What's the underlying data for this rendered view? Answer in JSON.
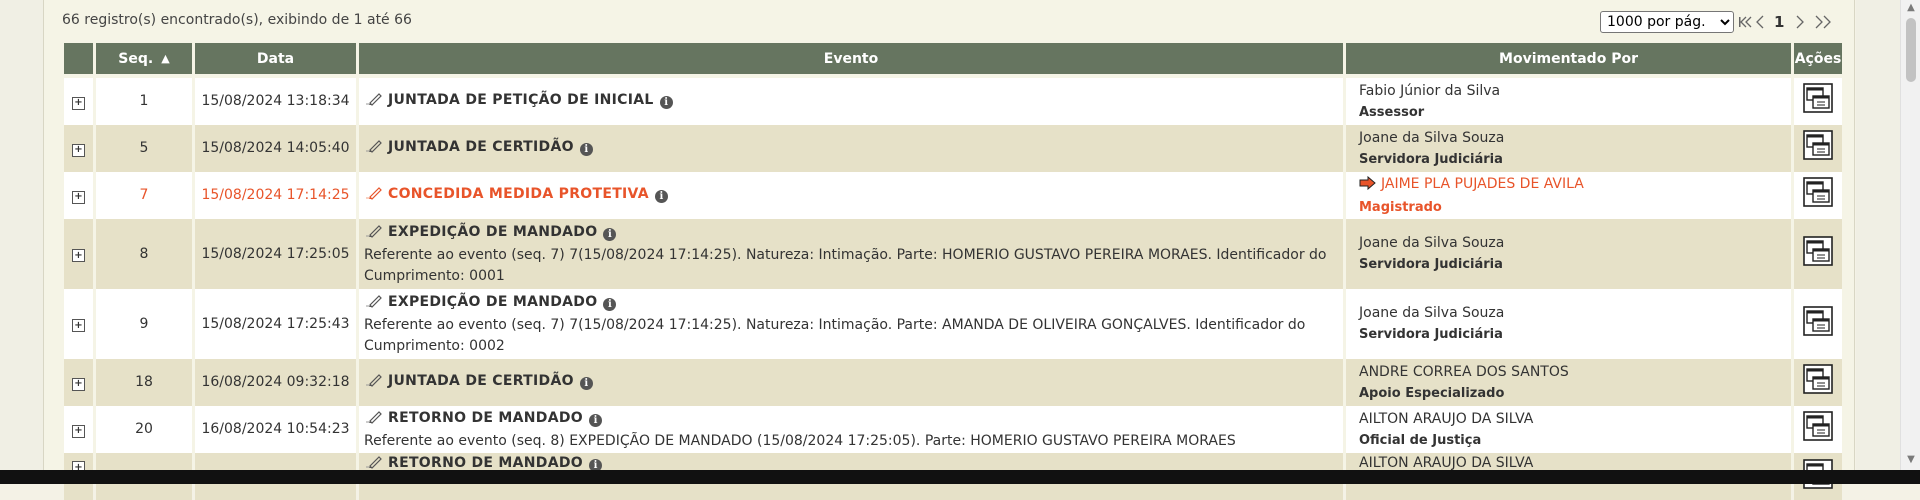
{
  "results": {
    "summary": "66 registro(s) encontrado(s), exibindo de 1 até 66",
    "per_page": "1000 por pág.",
    "per_page_options": [
      "1000 por pág."
    ],
    "current_page": "1"
  },
  "table": {
    "headers": {
      "seq": "Seq.",
      "data": "Data",
      "evento": "Evento",
      "movimentado_por": "Movimentado Por",
      "acoes": "Ações"
    },
    "rows": [
      {
        "seq": "1",
        "data": "15/08/2024 13:18:34",
        "evento": "JUNTADA DE PETIÇÃO DE INICIAL",
        "descricao": "",
        "movimentado_por": "Fabio Júnior da Silva",
        "cargo": "Assessor"
      },
      {
        "seq": "5",
        "data": "15/08/2024 14:05:40",
        "evento": "JUNTADA DE CERTIDÃO",
        "descricao": "",
        "movimentado_por": "Joane da Silva Souza",
        "cargo": "Servidora Judiciária"
      },
      {
        "seq": "7",
        "data": "15/08/2024 17:14:25",
        "evento": "CONCEDIDA MEDIDA PROTETIVA",
        "descricao": "",
        "movimentado_por": "JAIME PLA PUJADES DE AVILA",
        "cargo": "Magistrado"
      },
      {
        "seq": "8",
        "data": "15/08/2024 17:25:05",
        "evento": "EXPEDIÇÃO DE MANDADO",
        "descricao": "Referente ao evento (seq. 7) 7(15/08/2024 17:14:25). Natureza: Intimação. Parte: HOMERIO GUSTAVO PEREIRA MORAES. Identificador do Cumprimento: 0001",
        "movimentado_por": "Joane da Silva Souza",
        "cargo": "Servidora Judiciária"
      },
      {
        "seq": "9",
        "data": "15/08/2024 17:25:43",
        "evento": "EXPEDIÇÃO DE MANDADO",
        "descricao": "Referente ao evento (seq. 7) 7(15/08/2024 17:14:25). Natureza: Intimação. Parte: AMANDA DE OLIVEIRA GONÇALVES. Identificador do Cumprimento: 0002",
        "movimentado_por": "Joane da Silva Souza",
        "cargo": "Servidora Judiciária"
      },
      {
        "seq": "18",
        "data": "16/08/2024 09:32:18",
        "evento": "JUNTADA DE CERTIDÃO",
        "descricao": "",
        "movimentado_por": "ANDRE CORREA DOS SANTOS",
        "cargo": "Apoio Especializado"
      },
      {
        "seq": "20",
        "data": "16/08/2024 10:54:23",
        "evento": "RETORNO DE MANDADO",
        "descricao": "Referente ao evento (seq. 8) EXPEDIÇÃO DE MANDADO (15/08/2024 17:25:05). Parte: HOMERIO GUSTAVO PEREIRA MORAES",
        "movimentado_por": "AILTON ARAUJO DA SILVA",
        "cargo": "Oficial de Justiça"
      },
      {
        "seq": "",
        "data": "",
        "evento": "RETORNO DE MANDADO",
        "descricao": "",
        "movimentado_por": "AILTON ARAUJO DA SILVA",
        "cargo": ""
      }
    ]
  },
  "icons": {
    "expand": "expand-plus-icon",
    "pen": "pen-icon",
    "info": "info-icon",
    "arrow": "arrow-right-icon",
    "actions": "actions-windows-icon",
    "sort": "sort-asc-icon"
  },
  "colors": {
    "header_bg": "#667560",
    "alt_row_bg": "#e6e1c8",
    "highlight": "#e8542a",
    "page_bg": "#f5f4e6"
  }
}
